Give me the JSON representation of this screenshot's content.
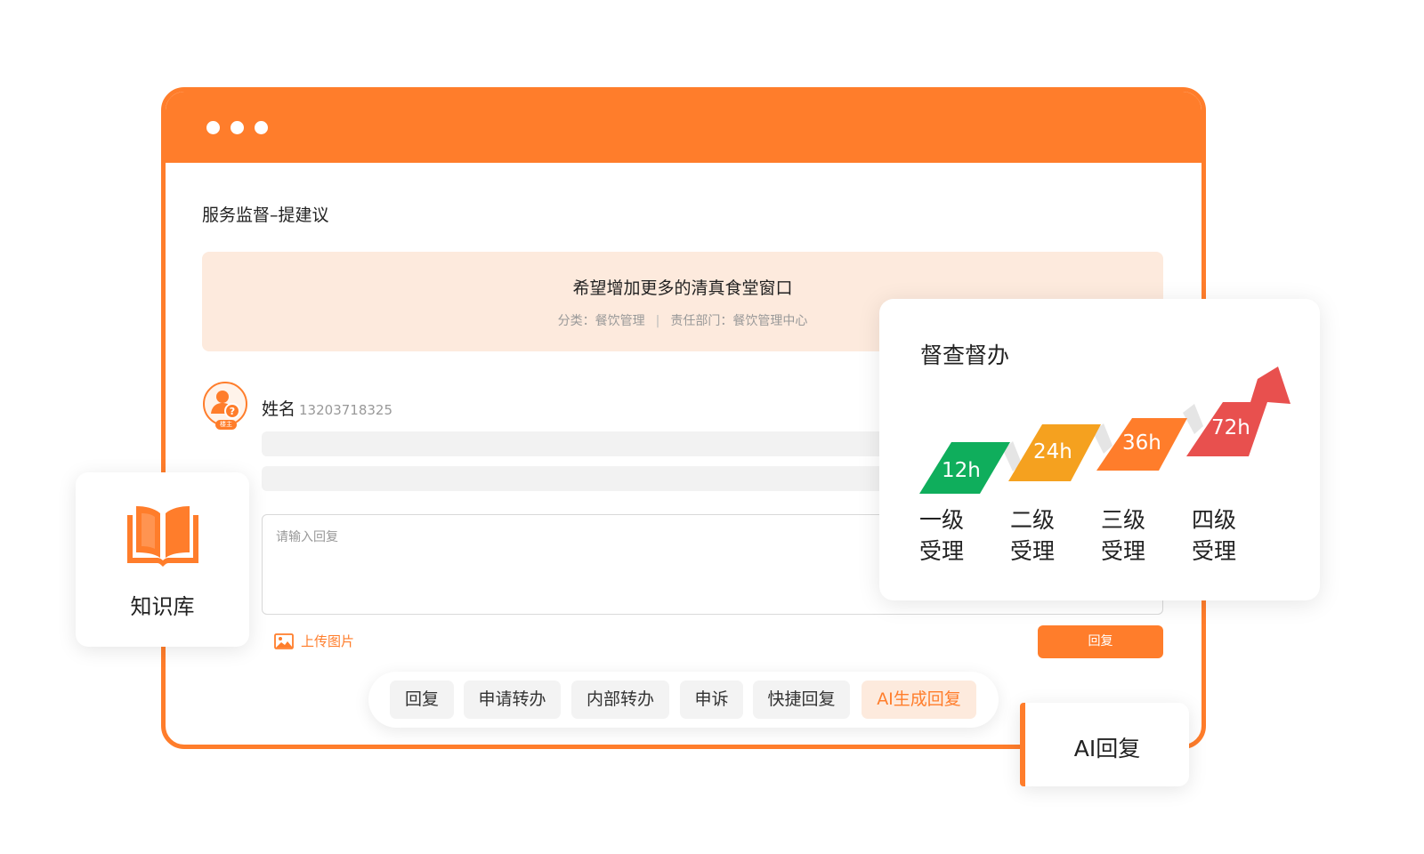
{
  "window": {
    "page_title": "服务监督–提建议",
    "suggestion": {
      "title": "希望增加更多的清真食堂窗口",
      "category_label": "分类：餐饮管理",
      "department_label": "责任部门：餐饮管理中心",
      "separator": "|"
    },
    "user": {
      "avatar_tag": "楼主",
      "name": "姓名",
      "phone": "13203718325"
    },
    "reply": {
      "placeholder": "请输入回复",
      "upload_label": "上传图片",
      "submit_label": "回复"
    }
  },
  "action_bar": {
    "buttons": [
      "回复",
      "申请转办",
      "内部转办",
      "申诉",
      "快捷回复",
      "AI生成回复"
    ]
  },
  "knowledge_card": {
    "label": "知识库",
    "icon": "book-icon"
  },
  "ai_card": {
    "label": "AI回复"
  },
  "supervision": {
    "title": "督查督办",
    "steps": [
      {
        "time": "12h",
        "level": "一级",
        "action": "受理",
        "color": "#0fae5c"
      },
      {
        "time": "24h",
        "level": "二级",
        "action": "受理",
        "color": "#f5a11f"
      },
      {
        "time": "36h",
        "level": "三级",
        "action": "受理",
        "color": "#ff7d2b"
      },
      {
        "time": "72h",
        "level": "四级",
        "action": "受理",
        "color": "#e8504e"
      }
    ]
  },
  "colors": {
    "accent": "#ff7d2b",
    "light_accent": "#fdeadd"
  }
}
